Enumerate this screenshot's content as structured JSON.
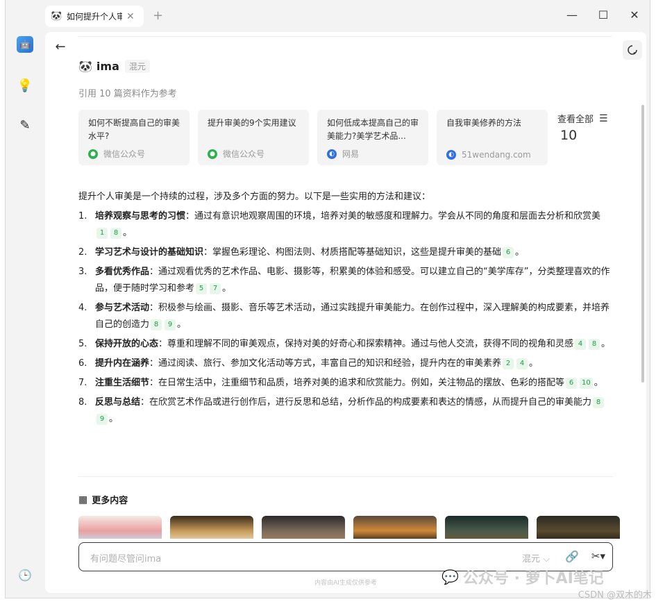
{
  "tab": {
    "icon": "🐼",
    "title": "如何提升个人审美",
    "close": "✕",
    "add": "+"
  },
  "window_controls": {
    "minimize": "—",
    "maximize": "☐",
    "close": "✕"
  },
  "rail": {
    "avatar": "🤖",
    "idea": "💡",
    "edit": "✎",
    "history": "🕒"
  },
  "header": {
    "back": "←"
  },
  "assistant": {
    "logo": "🐼",
    "name": "ima",
    "model": "混元"
  },
  "references": {
    "count_label": "引用 10 篇资料作为参考",
    "cards": [
      {
        "title": "如何不断提高自己的审美水平?",
        "source": "微信公众号",
        "source_type": "wechat"
      },
      {
        "title": "提升审美的9个实用建议",
        "source": "微信公众号",
        "source_type": "wechat"
      },
      {
        "title": "如何低成本提高自己的审美能力?美学艺术品...",
        "source": "网易",
        "source_type": "web"
      },
      {
        "title": "自我审美修养的方法",
        "source": "51wendang.com",
        "source_type": "web"
      }
    ],
    "view_all_label": "查看全部",
    "view_all_count": "10"
  },
  "answer": {
    "intro": "提升个人审美是一个持续的过程，涉及多个方面的努力。以下是一些实用的方法和建议：",
    "points": [
      {
        "num": "1.",
        "title": "培养观察与思考的习惯",
        "text": "：通过有意识地观察周围的环境，培养对美的敏感度和理解力。学会从不同的角度和层面去分析和欣赏美",
        "cites": [
          "1",
          "8"
        ]
      },
      {
        "num": "2.",
        "title": "学习艺术与设计的基础知识",
        "text": "：掌握色彩理论、构图法则、材质搭配等基础知识，这些是提升审美的基础",
        "cites": [
          "6"
        ]
      },
      {
        "num": "3.",
        "title": "多看优秀作品",
        "text": "：通过观看优秀的艺术作品、电影、摄影等，积累美的体验和感受。可以建立自己的“美学库存”，分类整理喜欢的作品，便于随时学习和参考",
        "cites": [
          "5",
          "7"
        ]
      },
      {
        "num": "4.",
        "title": "参与艺术活动",
        "text": "：积极参与绘画、摄影、音乐等艺术活动，通过实践提升审美能力。在创作过程中，深入理解美的构成要素，并培养自己的创造力",
        "cites": [
          "8",
          "9"
        ]
      },
      {
        "num": "5.",
        "title": "保持开放的心态",
        "text": "：尊重和理解不同的审美观点，保持对美的好奇心和探索精神。通过与他人交流，获得不同的视角和灵感",
        "cites": [
          "4",
          "8"
        ]
      },
      {
        "num": "6.",
        "title": "提升内在涵养",
        "text": "：通过阅读、旅行、参加文化活动等方式，丰富自己的知识和经验，提升内在的审美素养",
        "cites": [
          "2",
          "4"
        ]
      },
      {
        "num": "7.",
        "title": "注重生活细节",
        "text": "：在日常生活中，注重细节和品质，培养对美的追求和欣赏能力。例如，关注物品的摆放、色彩的搭配等",
        "cites": [
          "6",
          "10"
        ]
      },
      {
        "num": "8.",
        "title": "反思与总结",
        "text": "：在欣赏艺术作品或进行创作后，进行反思和总结，分析作品的构成要素和表达的情感，从而提升自己的审美能力",
        "cites": [
          "8",
          "9"
        ]
      }
    ],
    "end_mark": "。"
  },
  "more": {
    "title": "更多内容",
    "icon": "▦"
  },
  "input": {
    "placeholder": "有问题尽管问ima",
    "model": "混元 ⌵",
    "attach": "🔗",
    "tool": "✂▾"
  },
  "disclaimer": "内容由AI生成仅供参考",
  "watermark": {
    "icon": "💬",
    "text": "公众号 · 萝卜AI笔记"
  },
  "csdn": "CSDN @双木的木",
  "colors": {
    "accent_green": "#1f9e4a",
    "cite_bg": "#e8f6ec",
    "wechat": "#2bb24c",
    "web": "#2f6fe3"
  }
}
